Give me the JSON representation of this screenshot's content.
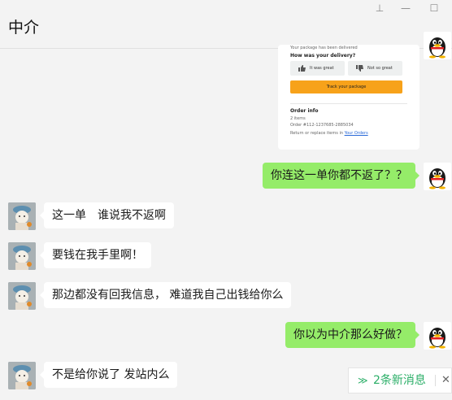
{
  "window": {
    "title": "中介",
    "pin_glyph": "⊥",
    "minimize_glyph": "—",
    "maximize_glyph": "☐"
  },
  "order_card": {
    "top_line": "Your package has been delivered",
    "feedback_heading": "How was your delivery?",
    "good_label": "It was great",
    "bad_label": "Not so great",
    "track_label": "Track your package",
    "order_info_heading": "Order info",
    "items": "2 items",
    "order_number": "Order #112-1237685-2885034",
    "returns_prefix": "Return or replace items in",
    "returns_link": "Your Orders"
  },
  "messages": [
    {
      "side": "out",
      "text": "你连这一单你都不返了？？"
    },
    {
      "side": "in",
      "text": "这一单　谁说我不返啊"
    },
    {
      "side": "in",
      "text": "要钱在我手里啊！"
    },
    {
      "side": "in",
      "text": "那边都没有回我信息，  难道我自己出钱给你么"
    },
    {
      "side": "out",
      "text": "你以为中介那么好做？"
    },
    {
      "side": "in",
      "text": "不是给你说了 发站内么"
    }
  ],
  "new_messages": {
    "label": "2条新消息",
    "chevron": "≫",
    "close": "✕"
  }
}
